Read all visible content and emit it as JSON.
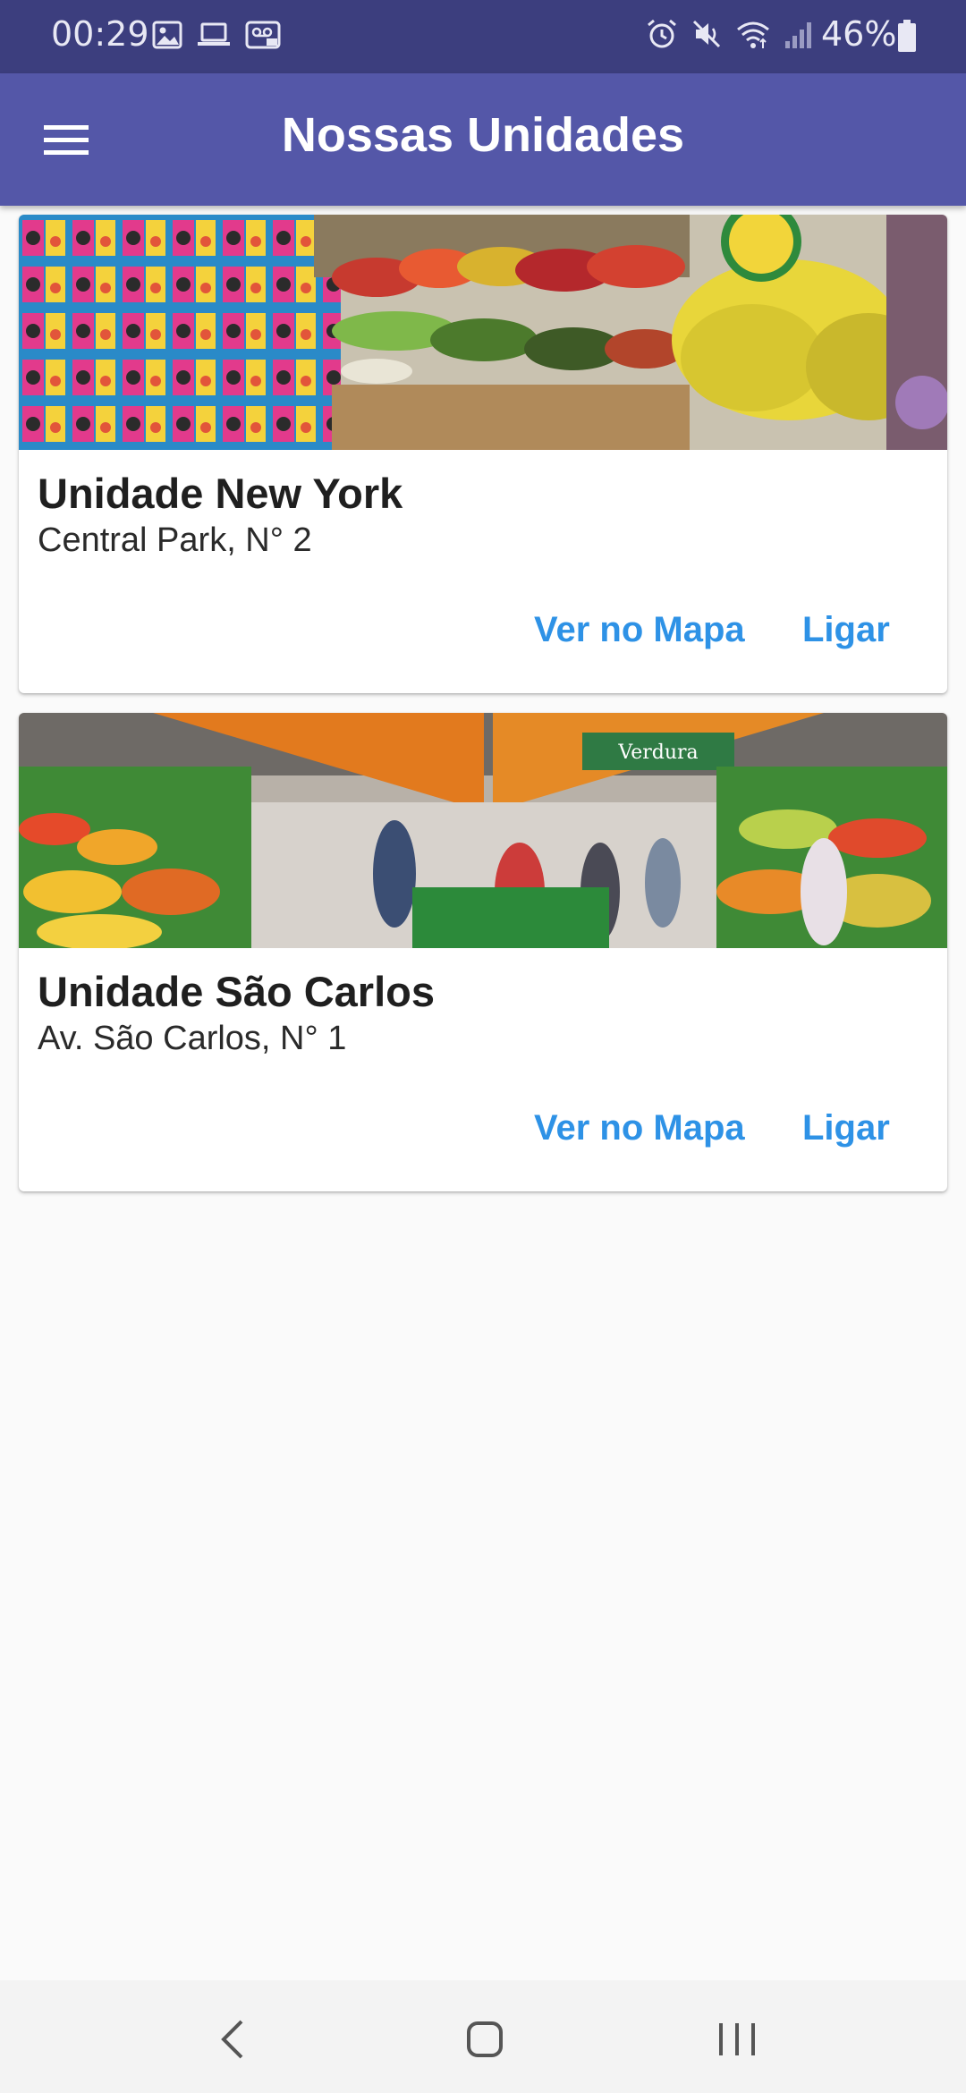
{
  "status_bar": {
    "time": "00:29",
    "battery": "46%",
    "left_icons": [
      "image-icon",
      "laptop-icon",
      "voicemail-icon"
    ],
    "right_icons": [
      "alarm-icon",
      "mute-icon",
      "wifi-icon",
      "signal-icon",
      "battery-icon"
    ]
  },
  "app_bar": {
    "title": "Nossas Unidades",
    "menu_icon": "hamburger-menu-icon"
  },
  "units": [
    {
      "name": "Unidade New York",
      "address": "Central Park, N° 2",
      "map_label": "Ver no Mapa",
      "call_label": "Ligar"
    },
    {
      "name": "Unidade São Carlos",
      "address": "Av. São Carlos, N° 1",
      "map_label": "Ver no Mapa",
      "call_label": "Ligar",
      "sign_text": "Verdura"
    }
  ],
  "navigation": {
    "icons": [
      "back-icon",
      "home-icon",
      "recent-apps-icon"
    ]
  },
  "colors": {
    "status_bar": "#3c3e7e",
    "app_bar": "#5457a8",
    "button_text": "#2e92e6",
    "background": "#fafafa"
  }
}
